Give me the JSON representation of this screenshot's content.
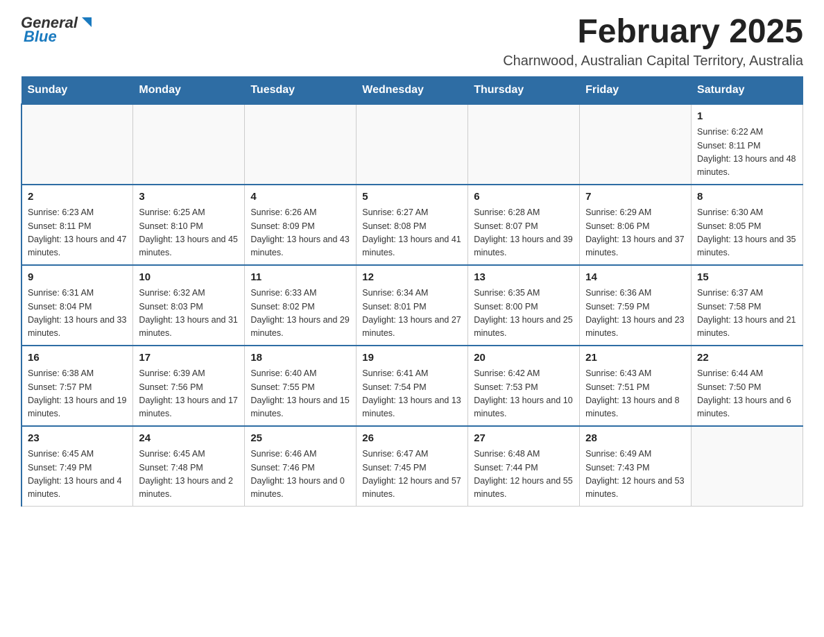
{
  "header": {
    "logo_general": "General",
    "logo_blue": "Blue",
    "month_year": "February 2025",
    "subtitle": "Charnwood, Australian Capital Territory, Australia"
  },
  "days_of_week": [
    "Sunday",
    "Monday",
    "Tuesday",
    "Wednesday",
    "Thursday",
    "Friday",
    "Saturday"
  ],
  "weeks": [
    [
      {
        "day": "",
        "info": ""
      },
      {
        "day": "",
        "info": ""
      },
      {
        "day": "",
        "info": ""
      },
      {
        "day": "",
        "info": ""
      },
      {
        "day": "",
        "info": ""
      },
      {
        "day": "",
        "info": ""
      },
      {
        "day": "1",
        "info": "Sunrise: 6:22 AM\nSunset: 8:11 PM\nDaylight: 13 hours and 48 minutes."
      }
    ],
    [
      {
        "day": "2",
        "info": "Sunrise: 6:23 AM\nSunset: 8:11 PM\nDaylight: 13 hours and 47 minutes."
      },
      {
        "day": "3",
        "info": "Sunrise: 6:25 AM\nSunset: 8:10 PM\nDaylight: 13 hours and 45 minutes."
      },
      {
        "day": "4",
        "info": "Sunrise: 6:26 AM\nSunset: 8:09 PM\nDaylight: 13 hours and 43 minutes."
      },
      {
        "day": "5",
        "info": "Sunrise: 6:27 AM\nSunset: 8:08 PM\nDaylight: 13 hours and 41 minutes."
      },
      {
        "day": "6",
        "info": "Sunrise: 6:28 AM\nSunset: 8:07 PM\nDaylight: 13 hours and 39 minutes."
      },
      {
        "day": "7",
        "info": "Sunrise: 6:29 AM\nSunset: 8:06 PM\nDaylight: 13 hours and 37 minutes."
      },
      {
        "day": "8",
        "info": "Sunrise: 6:30 AM\nSunset: 8:05 PM\nDaylight: 13 hours and 35 minutes."
      }
    ],
    [
      {
        "day": "9",
        "info": "Sunrise: 6:31 AM\nSunset: 8:04 PM\nDaylight: 13 hours and 33 minutes."
      },
      {
        "day": "10",
        "info": "Sunrise: 6:32 AM\nSunset: 8:03 PM\nDaylight: 13 hours and 31 minutes."
      },
      {
        "day": "11",
        "info": "Sunrise: 6:33 AM\nSunset: 8:02 PM\nDaylight: 13 hours and 29 minutes."
      },
      {
        "day": "12",
        "info": "Sunrise: 6:34 AM\nSunset: 8:01 PM\nDaylight: 13 hours and 27 minutes."
      },
      {
        "day": "13",
        "info": "Sunrise: 6:35 AM\nSunset: 8:00 PM\nDaylight: 13 hours and 25 minutes."
      },
      {
        "day": "14",
        "info": "Sunrise: 6:36 AM\nSunset: 7:59 PM\nDaylight: 13 hours and 23 minutes."
      },
      {
        "day": "15",
        "info": "Sunrise: 6:37 AM\nSunset: 7:58 PM\nDaylight: 13 hours and 21 minutes."
      }
    ],
    [
      {
        "day": "16",
        "info": "Sunrise: 6:38 AM\nSunset: 7:57 PM\nDaylight: 13 hours and 19 minutes."
      },
      {
        "day": "17",
        "info": "Sunrise: 6:39 AM\nSunset: 7:56 PM\nDaylight: 13 hours and 17 minutes."
      },
      {
        "day": "18",
        "info": "Sunrise: 6:40 AM\nSunset: 7:55 PM\nDaylight: 13 hours and 15 minutes."
      },
      {
        "day": "19",
        "info": "Sunrise: 6:41 AM\nSunset: 7:54 PM\nDaylight: 13 hours and 13 minutes."
      },
      {
        "day": "20",
        "info": "Sunrise: 6:42 AM\nSunset: 7:53 PM\nDaylight: 13 hours and 10 minutes."
      },
      {
        "day": "21",
        "info": "Sunrise: 6:43 AM\nSunset: 7:51 PM\nDaylight: 13 hours and 8 minutes."
      },
      {
        "day": "22",
        "info": "Sunrise: 6:44 AM\nSunset: 7:50 PM\nDaylight: 13 hours and 6 minutes."
      }
    ],
    [
      {
        "day": "23",
        "info": "Sunrise: 6:45 AM\nSunset: 7:49 PM\nDaylight: 13 hours and 4 minutes."
      },
      {
        "day": "24",
        "info": "Sunrise: 6:45 AM\nSunset: 7:48 PM\nDaylight: 13 hours and 2 minutes."
      },
      {
        "day": "25",
        "info": "Sunrise: 6:46 AM\nSunset: 7:46 PM\nDaylight: 13 hours and 0 minutes."
      },
      {
        "day": "26",
        "info": "Sunrise: 6:47 AM\nSunset: 7:45 PM\nDaylight: 12 hours and 57 minutes."
      },
      {
        "day": "27",
        "info": "Sunrise: 6:48 AM\nSunset: 7:44 PM\nDaylight: 12 hours and 55 minutes."
      },
      {
        "day": "28",
        "info": "Sunrise: 6:49 AM\nSunset: 7:43 PM\nDaylight: 12 hours and 53 minutes."
      },
      {
        "day": "",
        "info": ""
      }
    ]
  ]
}
